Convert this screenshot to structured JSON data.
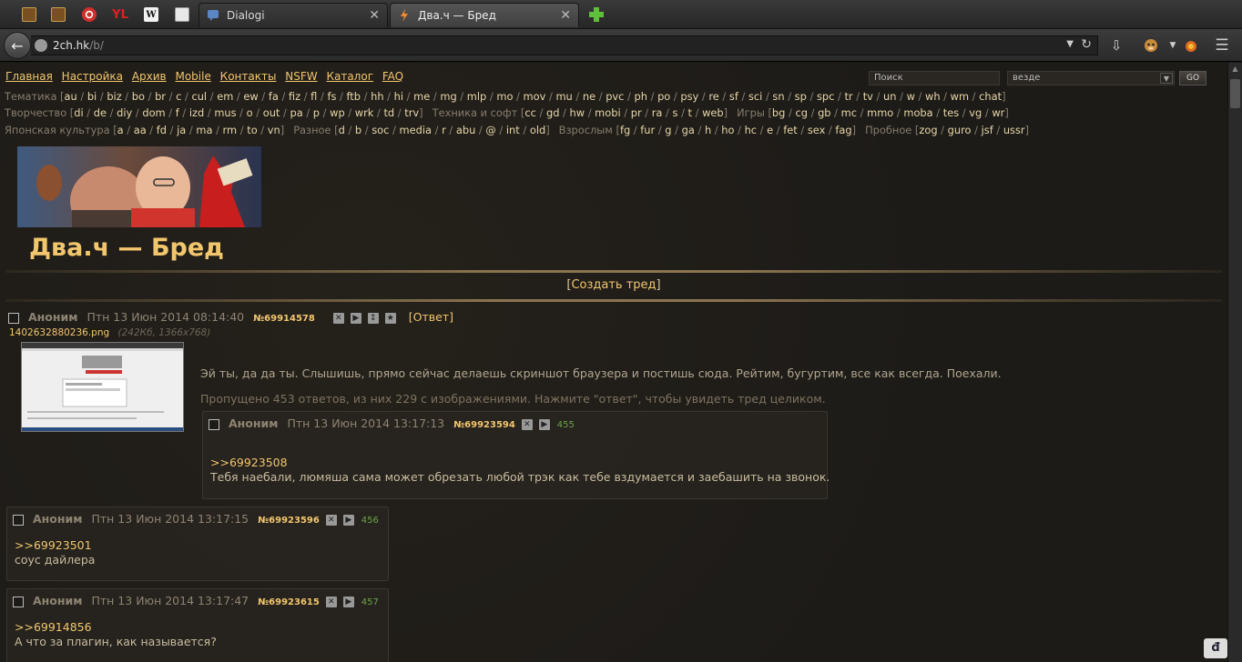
{
  "browser": {
    "pinned_tabs": [
      {
        "icon": "minecraft-icon",
        "color": "#8a5a2a",
        "glyph": ""
      },
      {
        "icon": "minecraft-icon",
        "color": "#8a5a2a",
        "glyph": ""
      },
      {
        "icon": "opera-red-icon",
        "color": "#d0302c",
        "glyph": ""
      },
      {
        "icon": "yl-icon",
        "color": "#3a1010",
        "glyph": "YL"
      },
      {
        "icon": "wikipedia-icon",
        "color": "#f0f0f0",
        "glyph": "W"
      },
      {
        "icon": "page-icon",
        "color": "#e8e8e8",
        "glyph": ""
      }
    ],
    "tabs": [
      {
        "title": "Dialogi",
        "active": false
      },
      {
        "title": "Два.ч — Бред",
        "active": true
      }
    ],
    "url_host": "2ch.hk",
    "url_path": "/b/"
  },
  "site": {
    "menu": [
      "Главная",
      "Настройка",
      "Архив",
      "Mobile",
      "Контакты",
      "NSFW",
      "Каталог",
      "FAQ"
    ],
    "search_placeholder": "Поиск",
    "search_scope": "везде",
    "go_label": "GO",
    "board_rows": [
      [
        {
          "name": "Тематика",
          "boards": [
            "au",
            "bi",
            "biz",
            "bo",
            "br",
            "c",
            "cul",
            "em",
            "ew",
            "fa",
            "fiz",
            "fl",
            "fs",
            "ftb",
            "hh",
            "hi",
            "me",
            "mg",
            "mlp",
            "mo",
            "mov",
            "mu",
            "ne",
            "pvc",
            "ph",
            "po",
            "psy",
            "re",
            "sf",
            "sci",
            "sn",
            "sp",
            "spc",
            "tr",
            "tv",
            "un",
            "w",
            "wh",
            "wm",
            "chat"
          ]
        }
      ],
      [
        {
          "name": "Творчество",
          "boards": [
            "di",
            "de",
            "diy",
            "dom",
            "f",
            "izd",
            "mus",
            "o",
            "out",
            "pa",
            "p",
            "wp",
            "wrk",
            "td",
            "trv"
          ]
        },
        {
          "name": "Техника и софт",
          "boards": [
            "cc",
            "gd",
            "hw",
            "mobi",
            "pr",
            "ra",
            "s",
            "t",
            "web"
          ]
        },
        {
          "name": "Игры",
          "boards": [
            "bg",
            "cg",
            "gb",
            "mc",
            "mmo",
            "moba",
            "tes",
            "vg",
            "wr"
          ]
        }
      ],
      [
        {
          "name": "Японская культура",
          "boards": [
            "a",
            "aa",
            "fd",
            "ja",
            "ma",
            "rm",
            "to",
            "vn"
          ]
        },
        {
          "name": "Разное",
          "boards": [
            "d",
            "b",
            "soc",
            "media",
            "r",
            "abu",
            "@",
            "int",
            "old"
          ]
        },
        {
          "name": "Взрослым",
          "boards": [
            "fg",
            "fur",
            "g",
            "ga",
            "h",
            "ho",
            "hc",
            "e",
            "fet",
            "sex",
            "fag"
          ]
        },
        {
          "name": "Пробное",
          "boards": [
            "zog",
            "guro",
            "jsf",
            "ussr"
          ]
        }
      ]
    ],
    "board_title": "Два.ч — Бред",
    "create_thread": "Создать тред"
  },
  "op": {
    "author": "Аноним",
    "date": "Птн 13 Июн 2014 08:14:40",
    "number": "№69914578",
    "reply_label": "Ответ",
    "file_name": "1402632880236.png",
    "file_info": "(242Кб, 1366x768)",
    "text": "Эй ты, да да ты. Слышишь, прямо сейчас делаешь скриншот браузера и постишь сюда. Рейтим, бугуртим, все как всегда. Поехали.",
    "omitted": "Пропущено 453 ответов, из них 229 с изображениями. Нажмите \"ответ\", чтобы увидеть тред целиком."
  },
  "replies": [
    {
      "author": "Аноним",
      "date": "Птн 13 Июн 2014 13:17:13",
      "number": "№69923594",
      "index": "455",
      "quote": ">>69923508",
      "text": "Тебя наебали, люмяша сама может обрезать любой трэк как тебе вздумается и заебашить на звонок."
    },
    {
      "author": "Аноним",
      "date": "Птн 13 Июн 2014 13:17:15",
      "number": "№69923596",
      "index": "456",
      "quote": ">>69923501",
      "text": "соус дайлера"
    },
    {
      "author": "Аноним",
      "date": "Птн 13 Июн 2014 13:17:47",
      "number": "№69923615",
      "index": "457",
      "quote": ">>69914856",
      "text": "А что за плагин, как называется?"
    }
  ]
}
